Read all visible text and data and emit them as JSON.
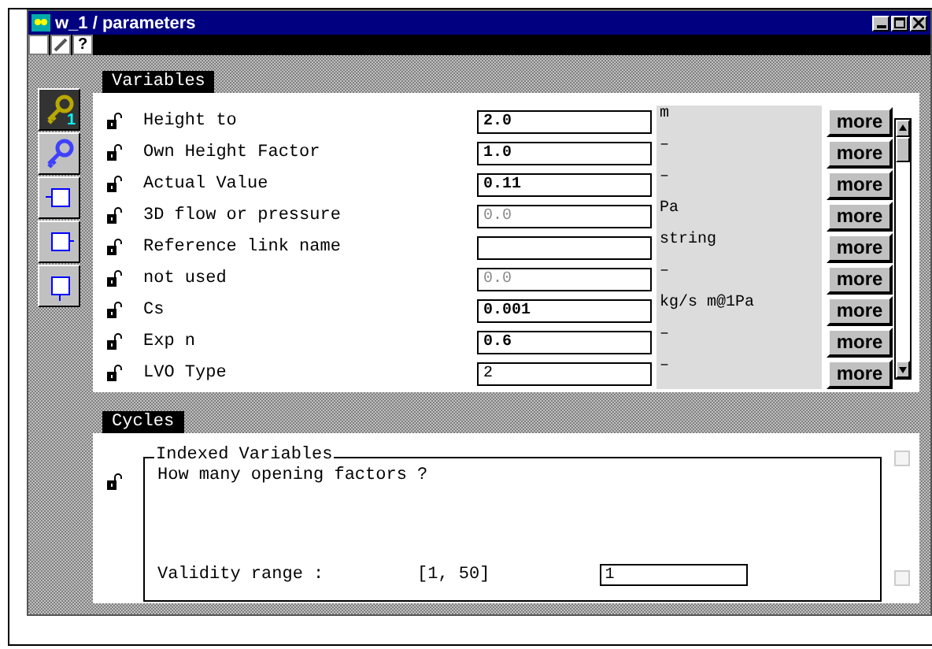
{
  "window": {
    "title": "w_1 / parameters"
  },
  "toolbar": {
    "help": "?"
  },
  "sidebar": {
    "key_badge": "1"
  },
  "variables": {
    "tab": "Variables",
    "rows": [
      {
        "label": "Height to",
        "value": "2.0",
        "modified": true,
        "disabled": false,
        "unit": "m",
        "button": "more"
      },
      {
        "label": "Own Height Factor",
        "value": "1.0",
        "modified": true,
        "disabled": false,
        "unit": "–",
        "button": "more"
      },
      {
        "label": "Actual Value",
        "value": "0.11",
        "modified": true,
        "disabled": false,
        "unit": "–",
        "button": "more"
      },
      {
        "label": "3D flow or pressure",
        "value": "0.0",
        "modified": false,
        "disabled": true,
        "unit": "Pa",
        "button": "more"
      },
      {
        "label": "Reference link name",
        "value": "",
        "unit": "string",
        "button": "more"
      },
      {
        "label": "not used",
        "value": "0.0",
        "modified": false,
        "disabled": true,
        "unit": "–",
        "button": "more"
      },
      {
        "label": "Cs",
        "value": "0.001",
        "modified": true,
        "disabled": false,
        "unit": "kg/s m@1Pa",
        "button": "more"
      },
      {
        "label": "Exp n",
        "value": "0.6",
        "modified": true,
        "disabled": false,
        "unit": "–",
        "button": "more"
      },
      {
        "label": "LVO Type",
        "value": "2",
        "modified": false,
        "disabled": false,
        "unit": "–",
        "button": "more"
      }
    ]
  },
  "cycles": {
    "tab": "Cycles",
    "group": "Indexed Variables",
    "question": "How many opening factors ?",
    "range_label": "Validity range :",
    "range": "[1, 50]",
    "value": "1"
  }
}
